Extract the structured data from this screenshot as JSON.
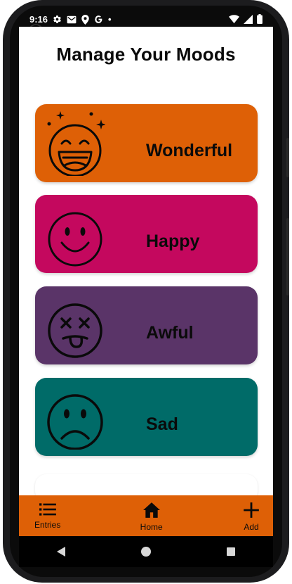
{
  "status_bar": {
    "time": "9:16",
    "dot": "•"
  },
  "page": {
    "title": "Manage Your Moods"
  },
  "moods": [
    {
      "label": "Wonderful",
      "color": "#de6006",
      "icon": "grinning-face-with-sparkles-icon"
    },
    {
      "label": "Happy",
      "color": "#c4085e",
      "icon": "smiling-face-icon"
    },
    {
      "label": "Awful",
      "color": "#5a3468",
      "icon": "dizzy-face-with-tongue-icon"
    },
    {
      "label": "Sad",
      "color": "#006b68",
      "icon": "frowning-face-icon"
    }
  ],
  "bottom_nav": {
    "background": "#de6006",
    "items": [
      {
        "label": "Entries",
        "icon": "list-icon"
      },
      {
        "label": "Home",
        "icon": "home-icon"
      },
      {
        "label": "Add",
        "icon": "plus-icon"
      }
    ]
  },
  "system_nav": {
    "icons": [
      "back-triangle-icon",
      "home-circle-icon",
      "recents-square-icon"
    ]
  }
}
